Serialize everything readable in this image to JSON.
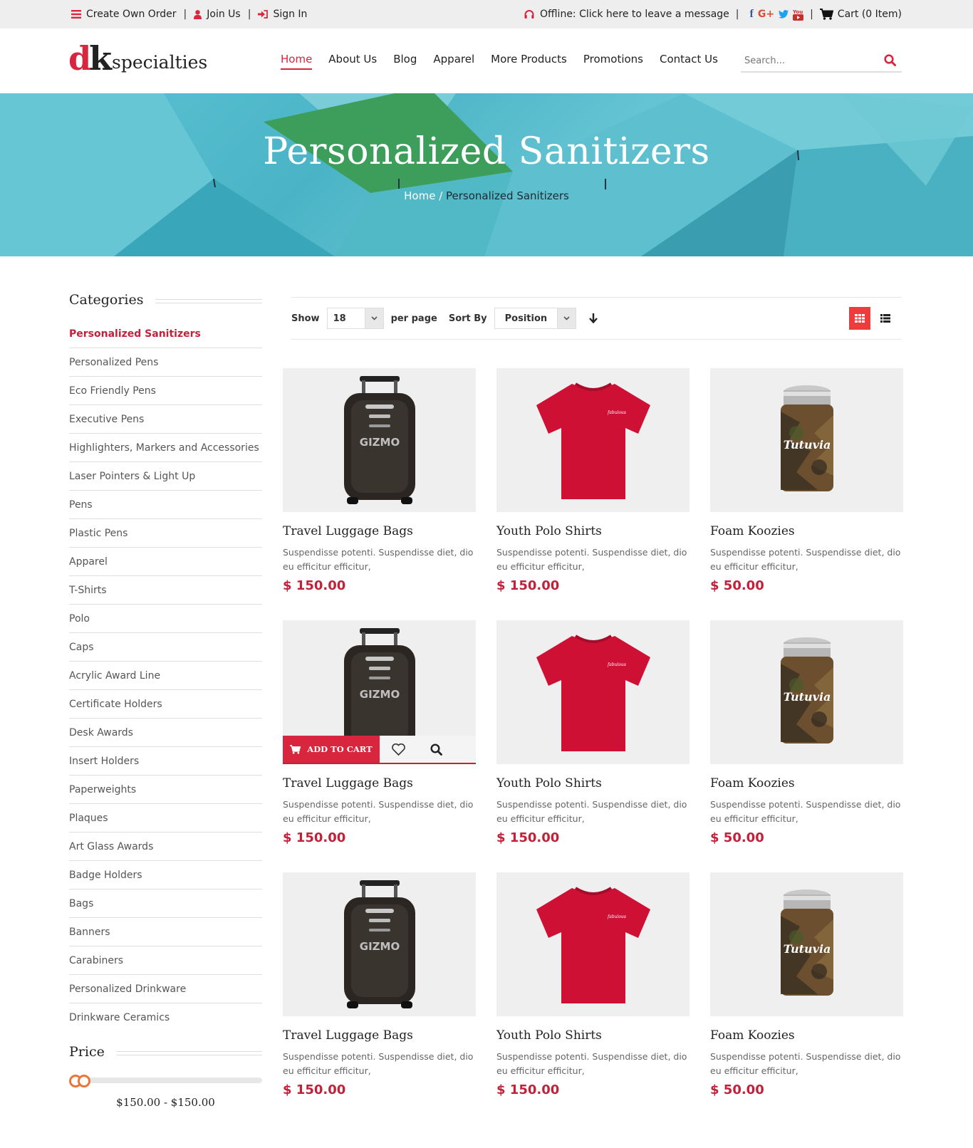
{
  "topbar": {
    "create_order": "Create Own Order",
    "join": "Join Us",
    "signin": "Sign In",
    "offline": "Offline: Click here to leave a message",
    "cart": "Cart (0 Item)"
  },
  "logo": {
    "dk_d": "d",
    "dk_k": "k",
    "text": "specialties"
  },
  "nav": [
    "Home",
    "About Us",
    "Blog",
    "Apparel",
    "More Products",
    "Promotions",
    "Contact Us"
  ],
  "search": {
    "placeholder": "Search..."
  },
  "banner": {
    "title": "Personalized Sanitizers",
    "crumb_home": "Home",
    "crumb_sep": " / ",
    "crumb_current": "Personalized Sanitizers"
  },
  "sidebar": {
    "categories_title": "Categories",
    "categories": [
      "Personalized Sanitizers",
      "Personalized Pens",
      "Eco Friendly Pens",
      "Executive Pens",
      "Highlighters, Markers and Accessories",
      "Laser Pointers & Light Up",
      "Pens",
      "Plastic Pens",
      "Apparel",
      "T-Shirts",
      "Polo",
      "Caps",
      "Acrylic Award Line",
      "Certificate Holders",
      "Desk Awards",
      "Insert Holders",
      "Paperweights",
      "Plaques",
      "Art Glass Awards",
      "Badge Holders",
      "Bags",
      "Banners",
      "Carabiners",
      "Personalized Drinkware",
      "Drinkware Ceramics"
    ],
    "price_title": "Price",
    "price_range": "$150.00 - $150.00"
  },
  "toolbar": {
    "show_label": "Show",
    "per_page_value": "18",
    "per_page_label": "per page",
    "sort_label": "Sort By",
    "sort_value": "Position"
  },
  "products": [
    {
      "title": "Travel Luggage Bags",
      "desc": "Suspendisse potenti. Suspendisse diet, dio eu efficitur efficitur,",
      "price": "$ 150.00",
      "kind": "bag"
    },
    {
      "title": "Youth Polo Shirts",
      "desc": "Suspendisse potenti. Suspendisse diet, dio eu efficitur efficitur,",
      "price": "$ 150.00",
      "kind": "shirt"
    },
    {
      "title": "Foam Koozies",
      "desc": "Suspendisse potenti. Suspendisse diet, dio eu efficitur efficitur,",
      "price": "$ 50.00",
      "kind": "koozie"
    },
    {
      "title": "Travel Luggage Bags",
      "desc": "Suspendisse potenti. Suspendisse diet, dio eu efficitur efficitur,",
      "price": "$ 150.00",
      "kind": "bag"
    },
    {
      "title": "Youth Polo Shirts",
      "desc": "Suspendisse potenti. Suspendisse diet, dio eu efficitur efficitur,",
      "price": "$ 150.00",
      "kind": "shirt"
    },
    {
      "title": "Foam Koozies",
      "desc": "Suspendisse potenti. Suspendisse diet, dio eu efficitur efficitur,",
      "price": "$ 50.00",
      "kind": "koozie"
    },
    {
      "title": "Travel Luggage Bags",
      "desc": "Suspendisse potenti. Suspendisse diet, dio eu efficitur efficitur,",
      "price": "$ 150.00",
      "kind": "bag"
    },
    {
      "title": "Youth Polo Shirts",
      "desc": "Suspendisse potenti. Suspendisse diet, dio eu efficitur efficitur,",
      "price": "$ 150.00",
      "kind": "shirt"
    },
    {
      "title": "Foam Koozies",
      "desc": "Suspendisse potenti. Suspendisse diet, dio eu efficitur efficitur,",
      "price": "$ 50.00",
      "kind": "koozie"
    }
  ],
  "hover": {
    "add_to_cart": "ADD TO CART"
  },
  "product_images": {
    "bag_logo": "GIZMO",
    "koozie_logo": "Tutuvia",
    "shirt_logo": "fabulous"
  },
  "colors": {
    "accent": "#d7263d",
    "price": "#c3213a",
    "grid_active": "#ee3c3c",
    "range_knob": "#e8763b"
  }
}
